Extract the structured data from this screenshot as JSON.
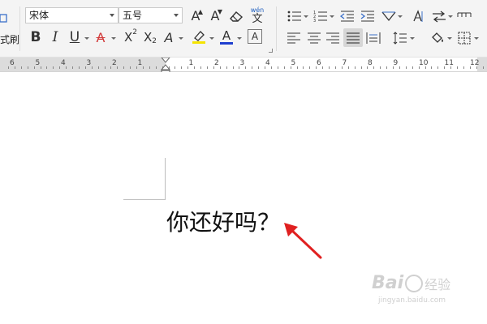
{
  "toolbar": {
    "left_partial_label": "式刷",
    "font_name": "宋体",
    "font_size": "五号",
    "phonetic_top": "wén",
    "phonetic_bottom": "文",
    "superscript_label": "X",
    "superscript_mark": "2",
    "subscript_label": "X",
    "subscript_mark": "2",
    "grow_font_label": "A",
    "shrink_font_label": "A",
    "bold_label": "B",
    "italic_label": "I",
    "underline_label": "U",
    "strike_label": "A",
    "text_effect_label": "A",
    "highlight_label": "A",
    "font_color_label": "A",
    "char_border_label": "A",
    "highlight_color": "#f5e400",
    "font_color": "#1f3fcf",
    "strike_color": "#d23a3a"
  },
  "ruler": {
    "labels": [
      "6",
      "5",
      "4",
      "3",
      "2",
      "1",
      "1",
      "2",
      "3",
      "4",
      "5",
      "6",
      "7",
      "8",
      "9",
      "10",
      "11",
      "12"
    ]
  },
  "document": {
    "text": "你还好吗？"
  },
  "annotation": {
    "arrow_color": "#e02020"
  },
  "watermark": {
    "brand": "Bai",
    "brand_suffix": "经验",
    "url": "jingyan.baidu.com"
  }
}
